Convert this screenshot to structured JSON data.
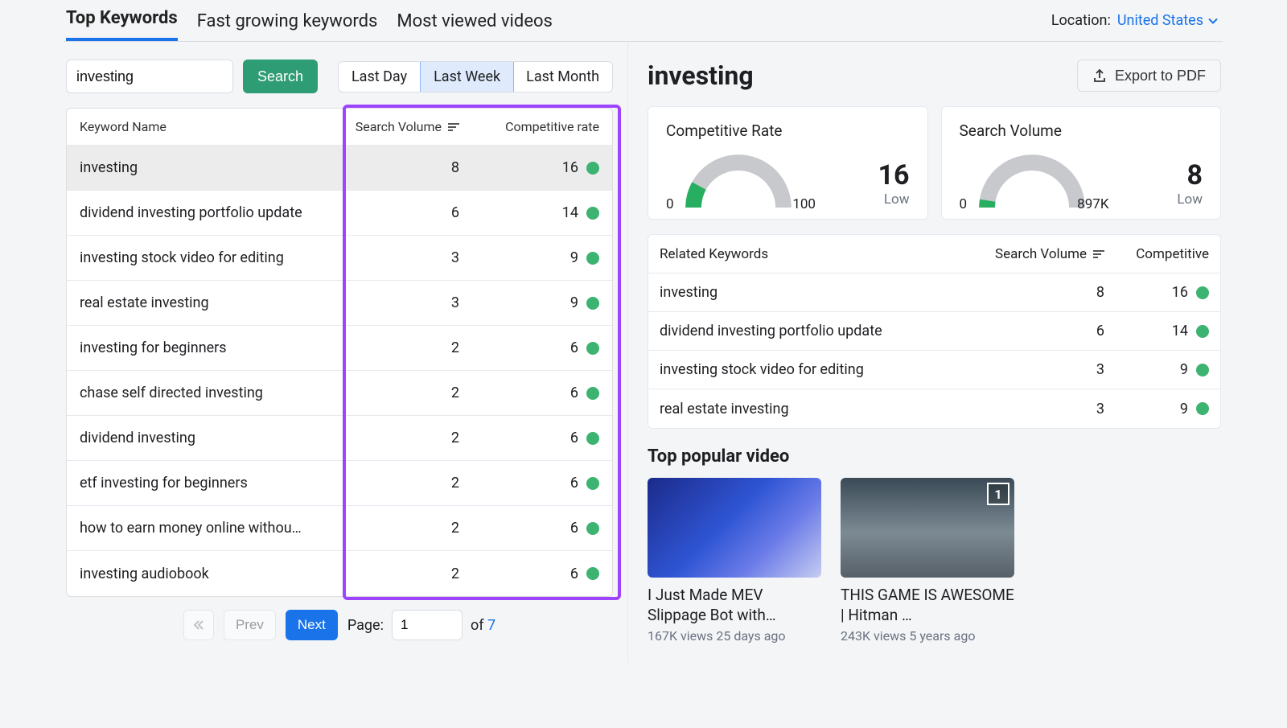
{
  "location": {
    "label": "Location:",
    "value": "United States"
  },
  "tabs": [
    "Top Keywords",
    "Fast growing keywords",
    "Most viewed videos"
  ],
  "active_tab_index": 0,
  "search": {
    "value": "investing",
    "button": "Search"
  },
  "period": {
    "options": [
      "Last Day",
      "Last Week",
      "Last Month"
    ],
    "active_index": 1
  },
  "table": {
    "headers": {
      "name": "Keyword Name",
      "volume": "Search Volume",
      "competitive": "Competitive rate"
    },
    "rows": [
      {
        "name": "investing",
        "volume": 8,
        "competitive": 16,
        "selected": true
      },
      {
        "name": "dividend investing portfolio update",
        "volume": 6,
        "competitive": 14
      },
      {
        "name": "investing stock video for editing",
        "volume": 3,
        "competitive": 9
      },
      {
        "name": "real estate investing",
        "volume": 3,
        "competitive": 9
      },
      {
        "name": "investing for beginners",
        "volume": 2,
        "competitive": 6
      },
      {
        "name": "chase self directed investing",
        "volume": 2,
        "competitive": 6
      },
      {
        "name": "dividend investing",
        "volume": 2,
        "competitive": 6
      },
      {
        "name": "etf investing for beginners",
        "volume": 2,
        "competitive": 6
      },
      {
        "name": "how to earn money online withou…",
        "volume": 2,
        "competitive": 6
      },
      {
        "name": "investing audiobook",
        "volume": 2,
        "competitive": 6
      }
    ],
    "pager": {
      "prev": "Prev",
      "next": "Next",
      "page_label": "Page:",
      "page_value": "1",
      "of": "of",
      "total": "7"
    }
  },
  "detail": {
    "title": "investing",
    "export": "Export to PDF",
    "gauges": {
      "competitive": {
        "title": "Competitive Rate",
        "min": "0",
        "max": "100",
        "value": "16",
        "label": "Low",
        "frac": 0.16
      },
      "volume": {
        "title": "Search Volume",
        "min": "0",
        "max": "897K",
        "value": "8",
        "label": "Low",
        "frac": 0.05
      }
    },
    "related": {
      "headers": {
        "name": "Related Keywords",
        "volume": "Search Volume",
        "competitive": "Competitive"
      },
      "rows": [
        {
          "name": "investing",
          "volume": 8,
          "competitive": 16
        },
        {
          "name": "dividend investing portfolio update",
          "volume": 6,
          "competitive": 14
        },
        {
          "name": "investing stock video for editing",
          "volume": 3,
          "competitive": 9
        },
        {
          "name": "real estate investing",
          "volume": 3,
          "competitive": 9
        }
      ]
    },
    "popular": {
      "title": "Top popular video",
      "videos": [
        {
          "title": "I Just Made MEV Slippage Bot with…",
          "meta": "167K views 25 days ago",
          "badge": ""
        },
        {
          "title": "THIS GAME IS AWESOME | Hitman …",
          "meta": "243K views 5 years ago",
          "badge": "1"
        }
      ]
    }
  }
}
